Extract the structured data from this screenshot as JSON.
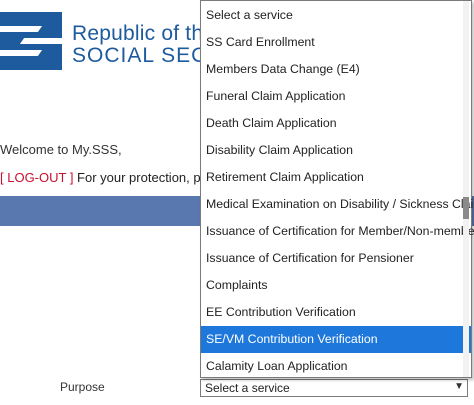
{
  "header": {
    "brand_line1": "Republic of the P",
    "brand_line2": "SOCIAL SECURI"
  },
  "welcome_text": "Welcome to My.SSS,",
  "logout": {
    "link": "[ LOG-OUT ]",
    "message": " For your protection, please l"
  },
  "form": {
    "purpose_label": "Purpose",
    "select_value": "Select a service"
  },
  "dropdown": {
    "options": [
      "Select a service",
      "SS Card Enrollment",
      "Members Data Change (E4)",
      "Funeral Claim Application",
      "Death Claim Application",
      "Disability Claim Application",
      "Retirement Claim Application",
      "Medical Examination on Disability / Sickness Claim",
      "Issuance of Certification for Member/Non-member",
      "Issuance of Certification for Pensioner",
      "Complaints",
      "EE Contribution Verification",
      "SE/VM Contribution Verification",
      "Calamity Loan Application"
    ],
    "highlighted_index": 12
  },
  "colors": {
    "brand": "#1d5a9e",
    "highlight": "#1e78dc",
    "logout": "#c8102e",
    "bar": "#5a78b0"
  }
}
